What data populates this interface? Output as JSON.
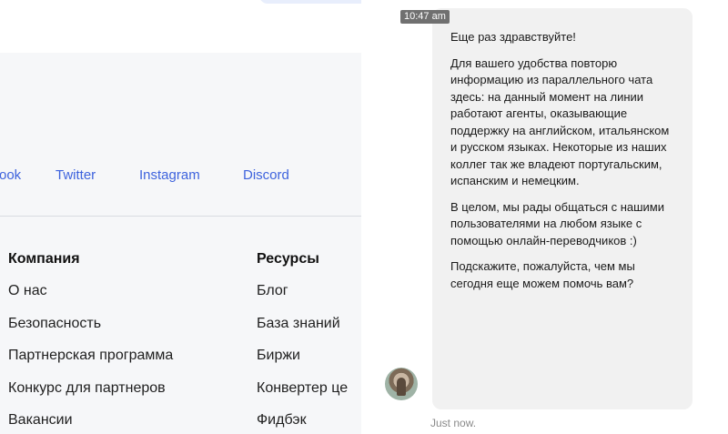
{
  "site": {
    "social": [
      "ook",
      "Twitter",
      "Instagram",
      "Discord"
    ],
    "columns": [
      {
        "heading": "Компания",
        "links": [
          "О нас",
          "Безопасность",
          "Партнерская программа",
          "Конкурс для партнеров",
          "Вакансии"
        ]
      },
      {
        "heading": "Ресурсы",
        "links": [
          "Блог",
          "База знаний",
          "Биржи",
          "Конвертер це",
          "Фидбэк"
        ]
      }
    ]
  },
  "chat": {
    "message_time": "10:47 am",
    "paragraphs": [
      "Еще раз здравствуйте!",
      "Для вашего удобства повторю информацию из параллельного чата здесь: на данный момент на линии работают агенты, оказывающие поддержку на английском, итальянском и русском языках. Некоторые из наших коллег так же владеют португальским, испанским и немецким.",
      "В целом, мы рады общаться с нашими пользователями на любом языке с помощью онлайн-переводчиков :)",
      "Подскажите, пожалуйста, чем мы сегодня еще можем помочь вам?"
    ],
    "relative_time": "Just now.",
    "avatar_icon": "agent-avatar-icon"
  }
}
